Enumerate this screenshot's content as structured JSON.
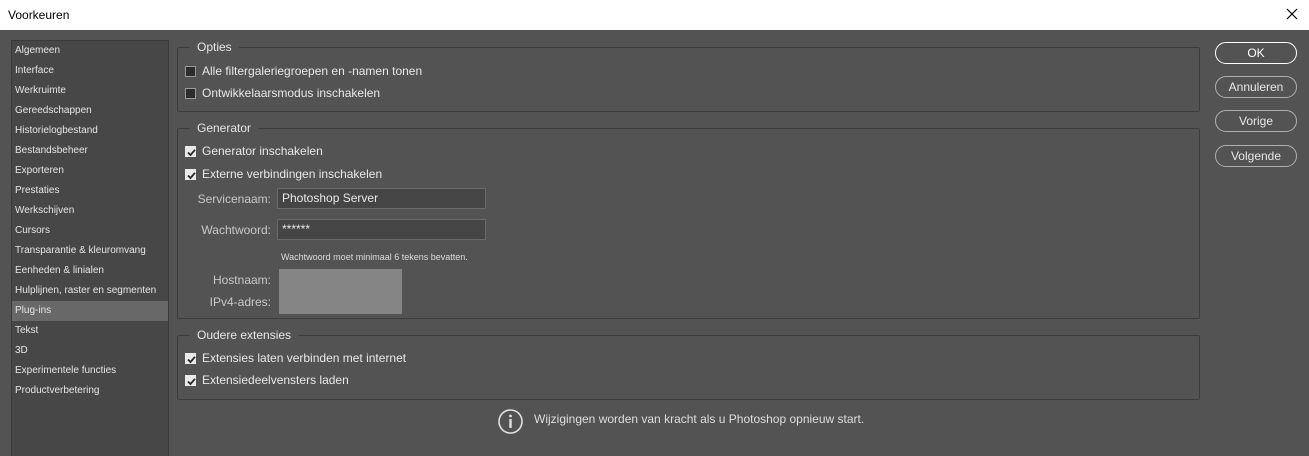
{
  "window": {
    "title": "Voorkeuren"
  },
  "sidebar": {
    "items": [
      {
        "label": "Algemeen"
      },
      {
        "label": "Interface"
      },
      {
        "label": "Werkruimte"
      },
      {
        "label": "Gereedschappen"
      },
      {
        "label": "Historielogbestand"
      },
      {
        "label": "Bestandsbeheer"
      },
      {
        "label": "Exporteren"
      },
      {
        "label": "Prestaties"
      },
      {
        "label": "Werkschijven"
      },
      {
        "label": "Cursors"
      },
      {
        "label": "Transparantie & kleuromvang"
      },
      {
        "label": "Eenheden & linialen"
      },
      {
        "label": "Hulplijnen, raster en segmenten"
      },
      {
        "label": "Plug-ins",
        "selected": true
      },
      {
        "label": "Tekst"
      },
      {
        "label": "3D"
      },
      {
        "label": "Experimentele functies"
      },
      {
        "label": "Productverbetering"
      }
    ]
  },
  "opties": {
    "title": "Opties",
    "filtergalerie": {
      "label": "Alle filtergaleriegroepen en -namen tonen",
      "checked": false
    },
    "ontwikkelaar": {
      "label": "Ontwikkelaarsmodus inschakelen",
      "checked": false
    }
  },
  "generator": {
    "title": "Generator",
    "enable": {
      "label": "Generator inschakelen",
      "checked": true
    },
    "extern": {
      "label": "Externe verbindingen inschakelen",
      "checked": true
    },
    "servicenaam_label": "Servicenaam:",
    "servicenaam_value": "Photoshop Server",
    "wachtwoord_label": "Wachtwoord:",
    "wachtwoord_value": "******",
    "hint": "Wachtwoord moet minimaal 6 tekens bevatten.",
    "hostnaam_label": "Hostnaam:",
    "ipv4_label": "IPv4-adres:"
  },
  "oudere": {
    "title": "Oudere extensies",
    "internet": {
      "label": "Extensies laten verbinden met internet",
      "checked": true
    },
    "panelen": {
      "label": "Extensiedeelvensters laden",
      "checked": true
    }
  },
  "buttons": {
    "ok": "OK",
    "annuleren": "Annuleren",
    "vorige": "Vorige",
    "volgende": "Volgende"
  },
  "notice": "Wijzigingen worden van kracht als u Photoshop opnieuw start.",
  "icons": {
    "close": "close-icon",
    "checkmark": "checkmark-icon",
    "info": "info-icon"
  }
}
